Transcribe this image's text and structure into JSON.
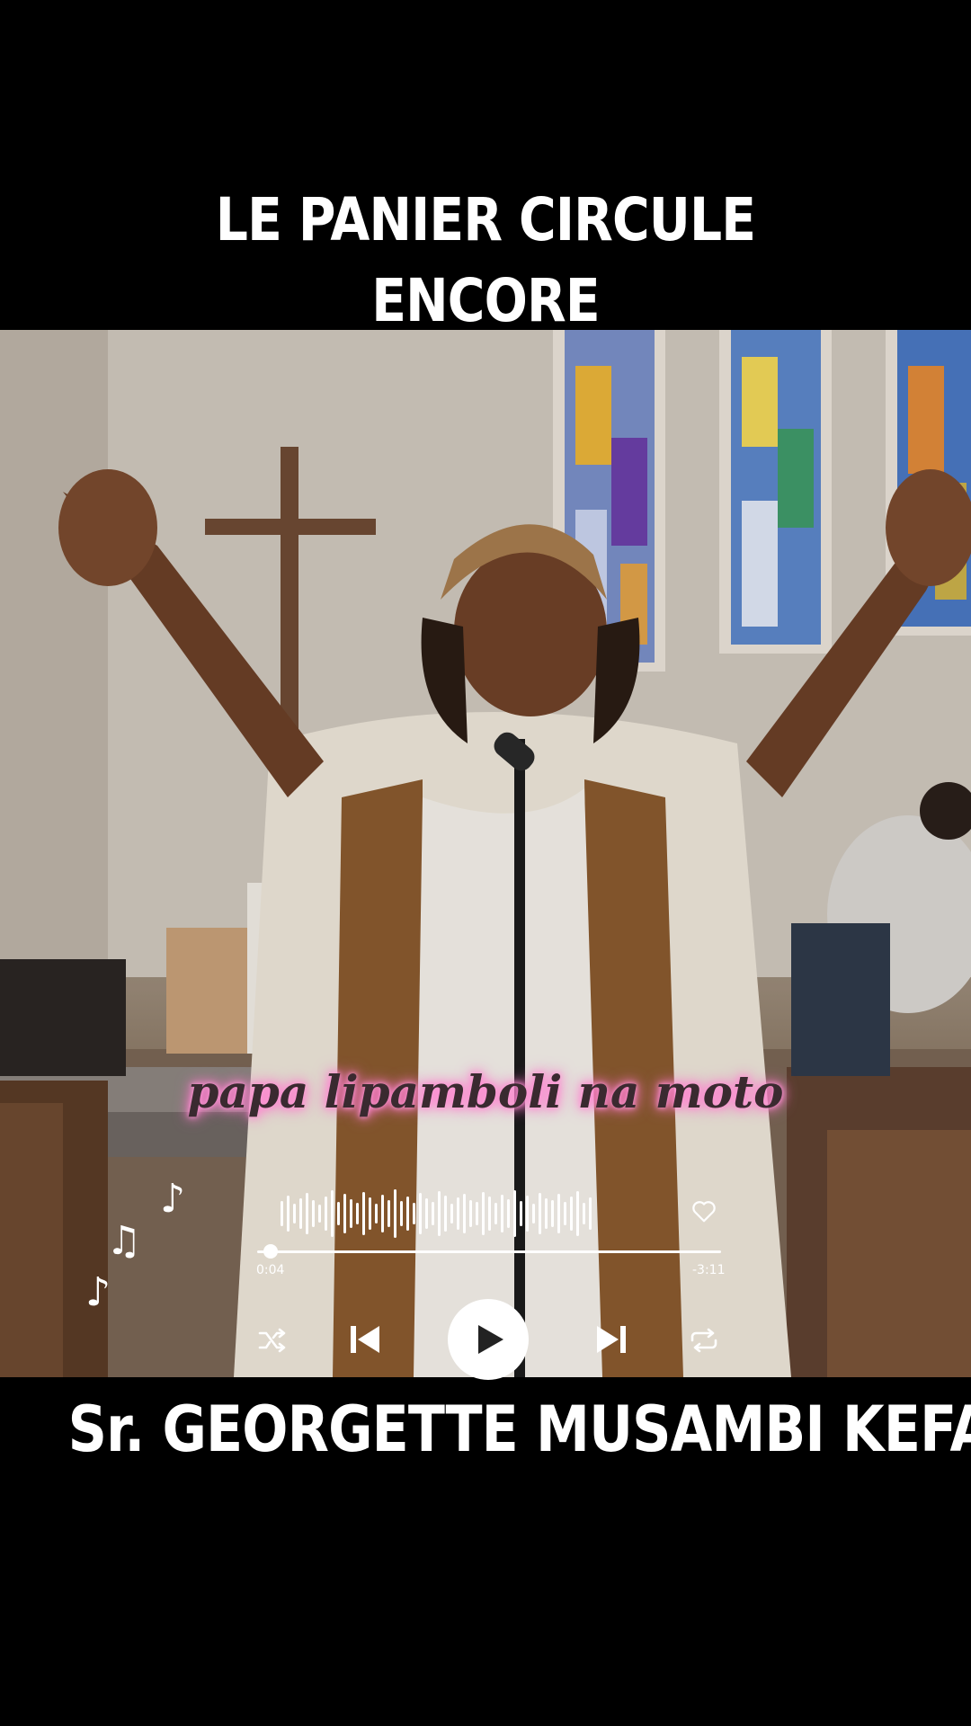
{
  "title": {
    "line1": "LE PANIER CIRCULE",
    "line2": "ENCORE"
  },
  "lyric": "papa lipamboli na moto",
  "player": {
    "elapsed": "0:04",
    "remaining": "-3:11",
    "progress_fraction": 0.03,
    "icons": {
      "shuffle": "shuffle-icon",
      "previous": "skip-previous-icon",
      "play": "play-icon",
      "next": "skip-next-icon",
      "repeat": "repeat-icon",
      "favorite": "heart-icon"
    }
  },
  "artist": "Sr. GEORGETTE MUSAMBI KEFA",
  "colors": {
    "background": "#000000",
    "lyric_glow": "#ff7fcf",
    "text": "#ffffff"
  }
}
